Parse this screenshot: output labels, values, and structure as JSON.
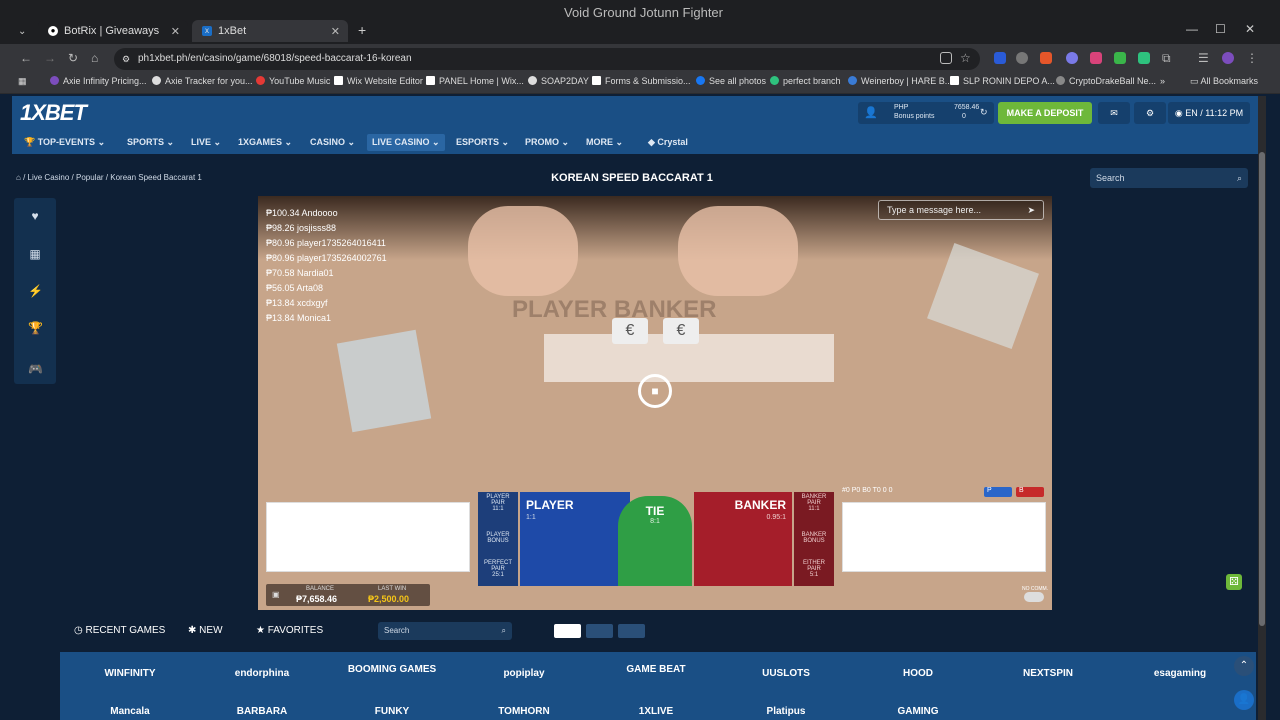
{
  "browser": {
    "window_title": "Void Ground Jotunn Fighter",
    "tabs": [
      {
        "label": "BotRix | Giveaways"
      },
      {
        "label": "1xBet"
      }
    ],
    "url": "ph1xbet.ph/en/casino/game/68018/speed-baccarat-16-korean",
    "bookmarks": [
      "Axie Infinity Pricing...",
      "Axie Tracker for you...",
      "YouTube Music",
      "Wix Website Editor",
      "PANEL Home | Wix...",
      "SOAP2DAY",
      "Forms & Submissio...",
      "See all photos",
      "perfect branch",
      "Weinerboy | HARE B...",
      "SLP RONIN DEPO A...",
      "CryptoDrakeBall Ne..."
    ],
    "all_bookmarks": "All Bookmarks"
  },
  "site": {
    "logo": "1XBET",
    "currency": "PHP",
    "balance_amount": "7658.46",
    "bonus_label": "Bonus points",
    "bonus_value": "0",
    "deposit_label": "MAKE A DEPOSIT",
    "lang_time": "EN / 11:12 PM",
    "nav": [
      "TOP-EVENTS",
      "SPORTS",
      "LIVE",
      "1XGAMES",
      "CASINO",
      "LIVE CASINO",
      "ESPORTS",
      "PROMO",
      "MORE",
      "Crystal"
    ]
  },
  "page": {
    "breadcrumbs": [
      "Live Casino",
      "Popular",
      "Korean Speed Baccarat 1"
    ],
    "title": "KOREAN SPEED BACCARAT 1",
    "search_placeholder": "Search"
  },
  "game": {
    "chat_placeholder": "Type a message here...",
    "winners": [
      "₱100.34 Andoooo",
      "₱98.26 josjisss88",
      "₱80.96 player1735264016411",
      "₱80.96 player1735264002761",
      "₱70.58 Nardia01",
      "₱56.05 Arta08",
      "₱13.84 xcdxgyf",
      "₱13.84 Monica1"
    ],
    "table_text": "PLAYER   BANKER",
    "bets": {
      "player_pair": "PLAYER PAIR",
      "player_pair_odds": "11:1",
      "player_bonus": "PLAYER BONUS",
      "perfect_pair": "PERFECT PAIR",
      "perfect_pair_odds": "25:1",
      "player": "PLAYER",
      "player_odds": "1:1",
      "tie": "TIE",
      "tie_odds": "8:1",
      "banker": "BANKER",
      "banker_odds": "0.95:1",
      "banker_pair": "BANKER PAIR",
      "banker_pair_odds": "11:1",
      "banker_bonus": "BANKER BONUS",
      "either_pair": "EITHER PAIR",
      "either_pair_odds": "5:1"
    },
    "road_stats": "#0  P0  B0  T0  0  0",
    "balance_label": "BALANCE",
    "balance_value": "₱7,658.46",
    "last_win_label": "LAST WIN",
    "last_win_value": "₱2,500.00",
    "no_comm": "NO COMM."
  },
  "footer": {
    "recent_games": "RECENT GAMES",
    "new": "NEW",
    "favorites": "FAVORITES",
    "search_placeholder": "Search"
  },
  "providers": [
    "WINFINITY",
    "endorphina",
    "BOOMING GAMES",
    "popiplay",
    "GAME BEAT",
    "UUSLOTS",
    "HOOD",
    "NEXTSPIN",
    "esagaming",
    "Mancala",
    "BARBARA",
    "FUNKY",
    "TOMHORN",
    "1XLIVE",
    "Platipus",
    "GAMING",
    "",
    ""
  ]
}
